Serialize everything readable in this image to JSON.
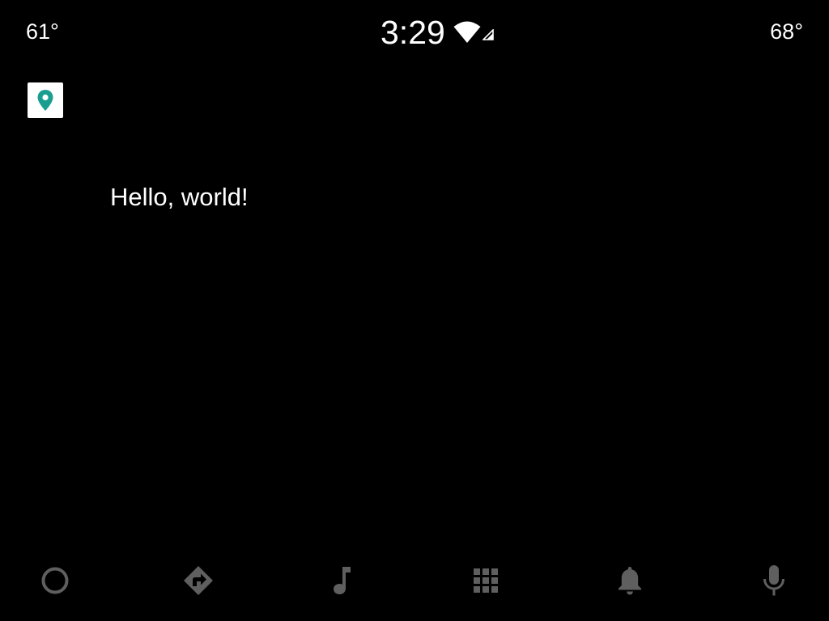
{
  "status_bar": {
    "temp_left": "61°",
    "temp_right": "68°",
    "clock": "3:29"
  },
  "app": {
    "icon": "map-pin-icon",
    "accent_color": "#1a9e8f"
  },
  "content": {
    "message": "Hello, world!"
  },
  "nav": {
    "items": [
      {
        "icon": "home-circle-icon"
      },
      {
        "icon": "navigation-icon"
      },
      {
        "icon": "music-note-icon"
      },
      {
        "icon": "app-grid-icon"
      },
      {
        "icon": "notification-bell-icon"
      },
      {
        "icon": "microphone-icon"
      }
    ],
    "icon_color": "#5f5f5f"
  }
}
